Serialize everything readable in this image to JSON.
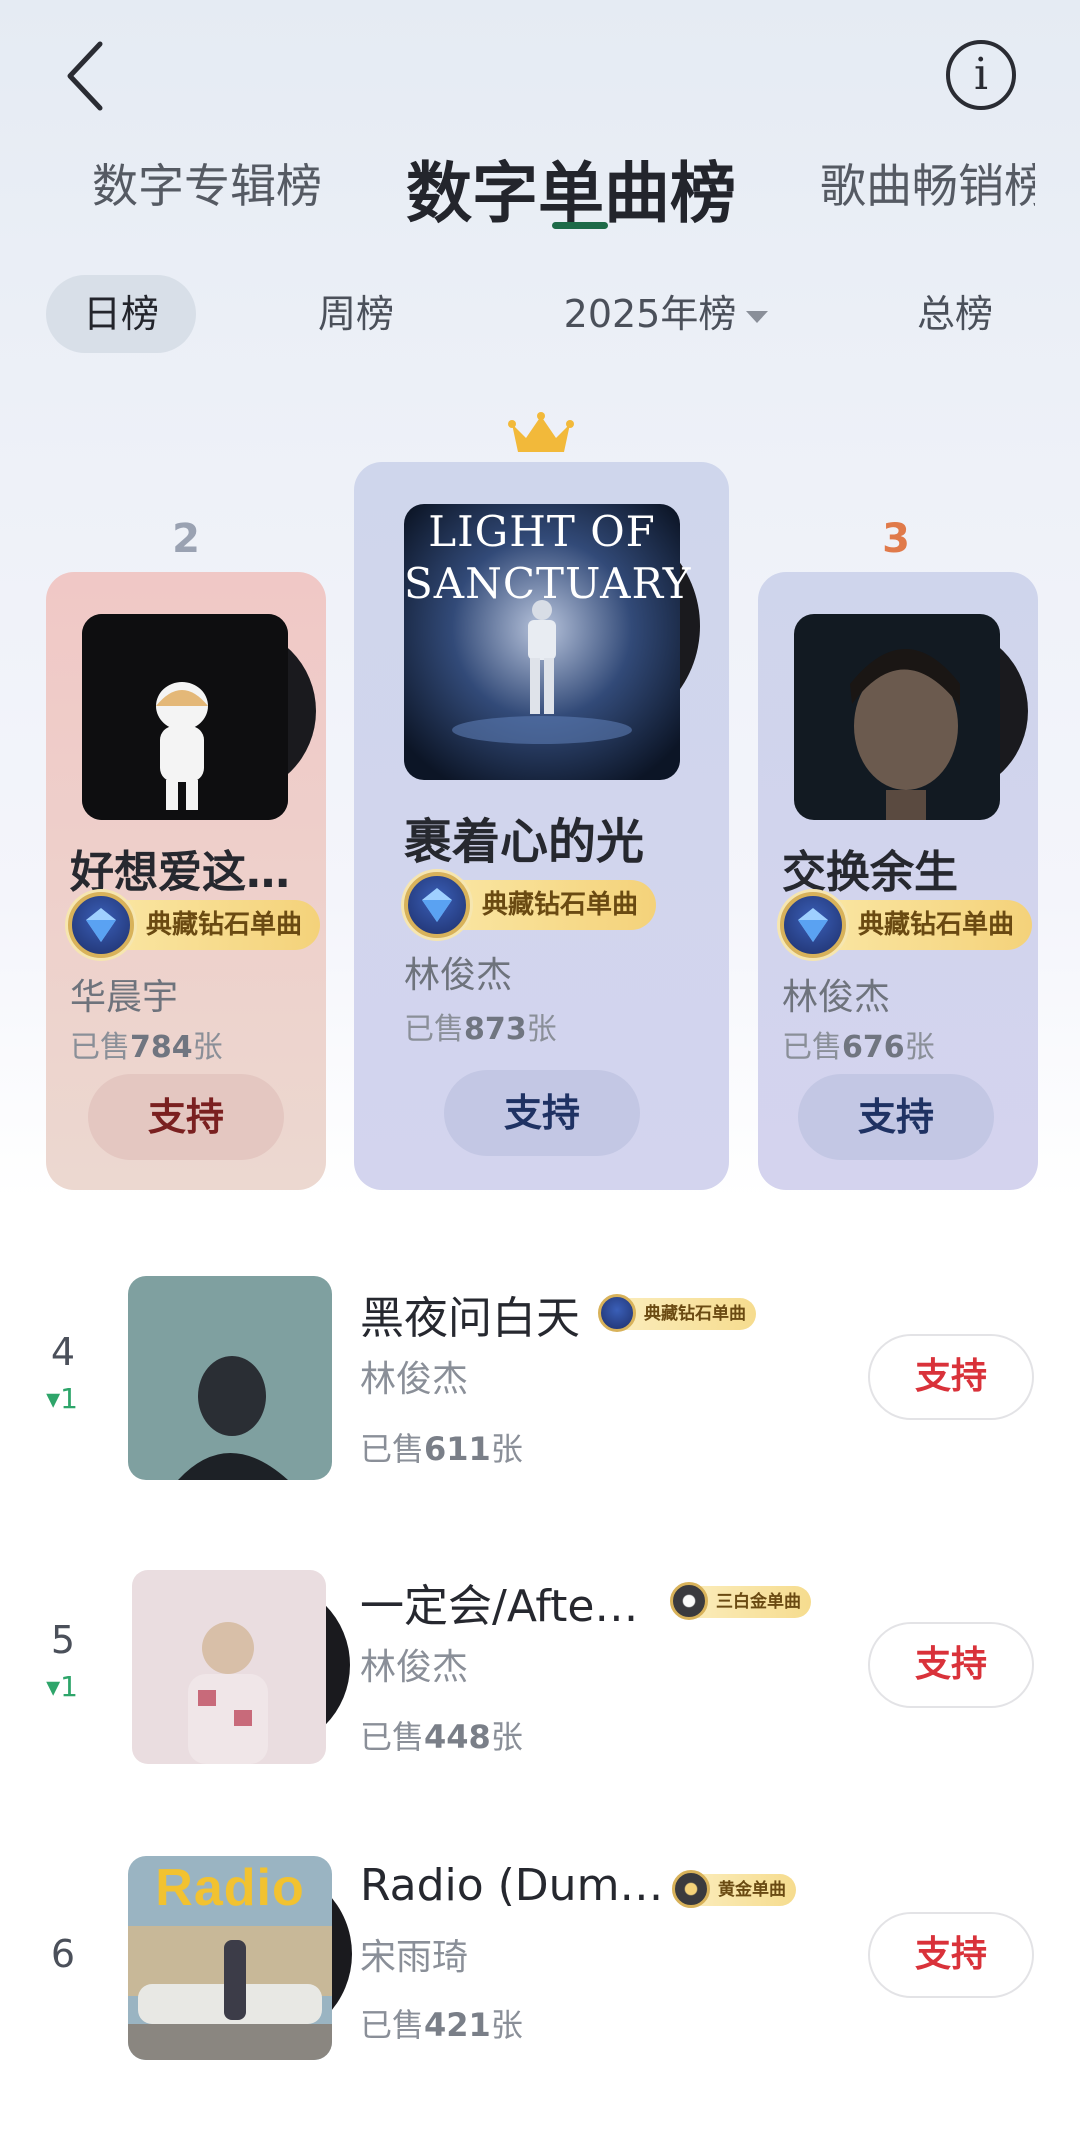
{
  "top_tabs": [
    {
      "label": "数字专辑榜"
    },
    {
      "label": "数字单曲榜",
      "active": true
    },
    {
      "label": "歌曲畅销榜"
    }
  ],
  "sub_tabs": [
    {
      "label": "日榜",
      "active": true
    },
    {
      "label": "周榜"
    },
    {
      "label": "2025年榜"
    },
    {
      "label": "总榜"
    }
  ],
  "podium": [
    {
      "rank": "2",
      "title": "好想爱这…",
      "badge": "典藏钻石单曲",
      "artist": "华晨宇",
      "sold_prefix": "已售",
      "sold": "784",
      "sold_suffix": "张",
      "button": "支持",
      "rank_color": "#9aa2b2",
      "button_text_color": "#7a2020"
    },
    {
      "rank": "1",
      "title": "裹着心的光",
      "badge": "典藏钻石单曲",
      "artist": "林俊杰",
      "sold_prefix": "已售",
      "sold": "873",
      "sold_suffix": "张",
      "button": "支持",
      "cover_text": "LIGHT OF SANCTUARY",
      "button_text_color": "#1f3263"
    },
    {
      "rank": "3",
      "title": "交换余生",
      "badge": "典藏钻石单曲",
      "artist": "林俊杰",
      "sold_prefix": "已售",
      "sold": "676",
      "sold_suffix": "张",
      "button": "支持",
      "rank_color": "#e07a4a",
      "button_text_color": "#1f3263"
    }
  ],
  "list": [
    {
      "rank": "4",
      "change": "▾1",
      "title": "黑夜问白天",
      "badge": "典藏钻石单曲",
      "artist": "林俊杰",
      "sold_prefix": "已售",
      "sold": "611",
      "sold_suffix": "张",
      "button": "支持"
    },
    {
      "rank": "5",
      "change": "▾1",
      "title": "一定会/Afte…",
      "badge": "三白金单曲",
      "artist": "林俊杰",
      "sold_prefix": "已售",
      "sold": "448",
      "sold_suffix": "张",
      "button": "支持"
    },
    {
      "rank": "6",
      "change": "",
      "title": "Radio (Dum…",
      "badge": "黄金单曲",
      "artist": "宋雨琦",
      "sold_prefix": "已售",
      "sold": "421",
      "sold_suffix": "张",
      "button": "支持",
      "cover_text": "Radio"
    }
  ]
}
